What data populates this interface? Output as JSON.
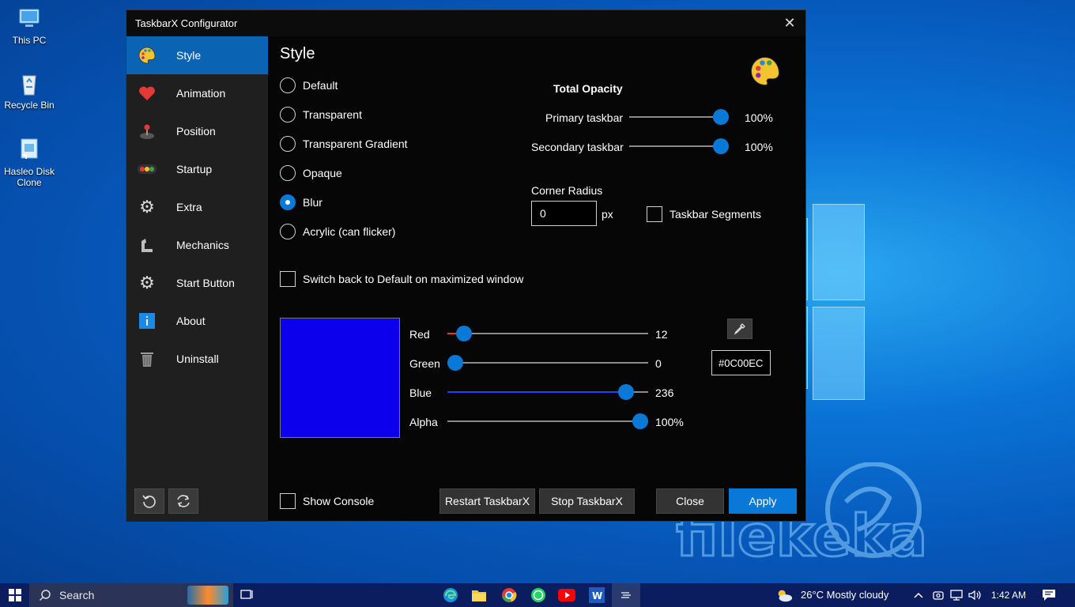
{
  "desktop": {
    "icons": [
      {
        "label": "This PC"
      },
      {
        "label": "Recycle Bin"
      },
      {
        "label": "Hasleo Disk Clone"
      }
    ]
  },
  "window": {
    "title": "TaskbarX Configurator",
    "sidebar": {
      "items": [
        {
          "label": "Style",
          "icon": "palette-icon",
          "active": true
        },
        {
          "label": "Animation",
          "icon": "heart-icon"
        },
        {
          "label": "Position",
          "icon": "joystick-icon"
        },
        {
          "label": "Startup",
          "icon": "traffic-light-icon"
        },
        {
          "label": "Extra",
          "icon": "gear-icon"
        },
        {
          "label": "Mechanics",
          "icon": "arm-icon"
        },
        {
          "label": "Start Button",
          "icon": "gear-icon"
        },
        {
          "label": "About",
          "icon": "info-icon"
        },
        {
          "label": "Uninstall",
          "icon": "trash-icon"
        }
      ],
      "bottom_buttons": [
        "undo-icon",
        "refresh-icon"
      ]
    },
    "style": {
      "heading": "Style",
      "options": [
        "Default",
        "Transparent",
        "Transparent Gradient",
        "Opaque",
        "Blur",
        "Acrylic (can flicker)"
      ],
      "selected": "Blur",
      "switch_back_label": "Switch back to Default on maximized window"
    },
    "opacity": {
      "heading": "Total Opacity",
      "primary_label": "Primary taskbar",
      "primary_value": "100%",
      "primary_fraction": 1.0,
      "secondary_label": "Secondary taskbar",
      "secondary_value": "100%",
      "secondary_fraction": 1.0
    },
    "corner": {
      "label": "Corner Radius",
      "value": "0",
      "unit": "px",
      "segments_label": "Taskbar Segments"
    },
    "color": {
      "swatch": "#0C00EC",
      "hex_value": "#0C00EC",
      "red_label": "Red",
      "red_value": "12",
      "red_fraction": 0.047,
      "green_label": "Green",
      "green_value": "0",
      "green_fraction": 0.0,
      "blue_label": "Blue",
      "blue_value": "236",
      "blue_fraction": 0.925,
      "alpha_label": "Alpha",
      "alpha_value": "100%",
      "alpha_fraction": 1.0
    },
    "footer": {
      "show_console": "Show Console",
      "restart": "Restart TaskbarX",
      "stop": "Stop TaskbarX",
      "close": "Close",
      "apply": "Apply"
    }
  },
  "taskbar": {
    "search_placeholder": "Search",
    "weather": "26°C  Mostly cloudy",
    "time": "1:42 AM"
  },
  "colors": {
    "accent": "#0A78D7",
    "sidebar_active": "#0A63B3",
    "window_bg": "#060606",
    "sidebar_bg": "#1F1F1F"
  }
}
